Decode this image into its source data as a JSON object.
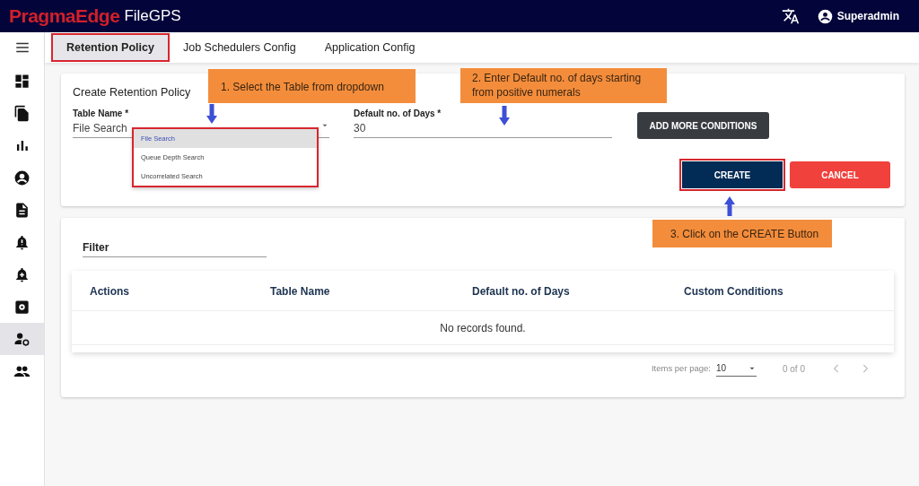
{
  "header": {
    "brand": "PragmaEdge",
    "product": "FileGPS",
    "user": "Superadmin"
  },
  "sidebar": {
    "items": [
      {
        "kind": "dashboard",
        "selected": false
      },
      {
        "kind": "files",
        "selected": false
      },
      {
        "kind": "chart",
        "selected": false
      },
      {
        "kind": "account",
        "selected": false
      },
      {
        "kind": "document",
        "selected": false
      },
      {
        "kind": "alert",
        "selected": false
      },
      {
        "kind": "add-alert",
        "selected": false
      },
      {
        "kind": "settings",
        "selected": false
      },
      {
        "kind": "admin",
        "selected": true
      },
      {
        "kind": "users",
        "selected": false
      }
    ]
  },
  "tabs": [
    {
      "label": "Retention Policy",
      "selected": true
    },
    {
      "label": "Job Schedulers Config",
      "selected": false
    },
    {
      "label": "Application Config",
      "selected": false
    }
  ],
  "form": {
    "title": "Create Retention Policy",
    "fields": [
      {
        "kind": "select",
        "label": "Table Name *",
        "value": "File Search"
      },
      {
        "kind": "text",
        "label": "Default no. of Days *",
        "value": "30"
      }
    ],
    "add_button": "ADD MORE CONDITIONS",
    "create_button": "CREATE",
    "cancel_button": "CANCEL"
  },
  "dropdown": {
    "options": [
      {
        "label": "File Search",
        "selected": true
      },
      {
        "label": "Queue Depth Search",
        "selected": false
      },
      {
        "label": "Uncorrelated Search",
        "selected": false
      }
    ]
  },
  "filter": {
    "placeholder": "Filter"
  },
  "table": {
    "columns": [
      "Actions",
      "Table Name",
      "Default no. of Days",
      "Custom Conditions"
    ],
    "empty_message": "No records found."
  },
  "paginator": {
    "label": "Items per page:",
    "page_size": "10",
    "range": "0 of 0"
  },
  "annotations": [
    {
      "text": "1. Select the Table from dropdown"
    },
    {
      "text": "2. Enter Default no. of days starting from positive numerals"
    },
    {
      "text": "3. Click on the CREATE Button"
    }
  ]
}
